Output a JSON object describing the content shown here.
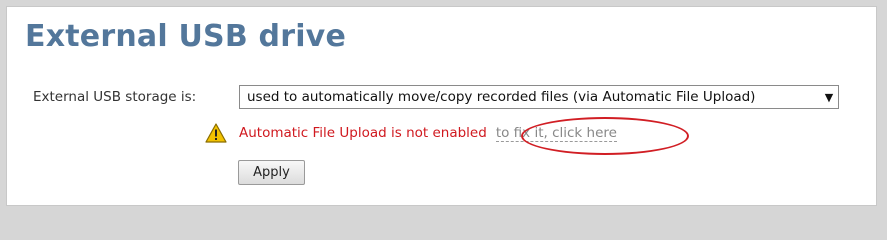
{
  "section": {
    "title": "External USB drive"
  },
  "storage": {
    "label": "External USB storage is:",
    "selected_value": "used to automatically move/copy recorded files (via Automatic File Upload)"
  },
  "warning": {
    "icon": "warning-triangle-icon",
    "message": "Automatic File Upload is not enabled",
    "link_text": "to fix it, click here",
    "message_color": "#d0191f"
  },
  "actions": {
    "apply_label": "Apply"
  },
  "colors": {
    "title": "#53779b",
    "highlight_circle": "#d11e24"
  }
}
